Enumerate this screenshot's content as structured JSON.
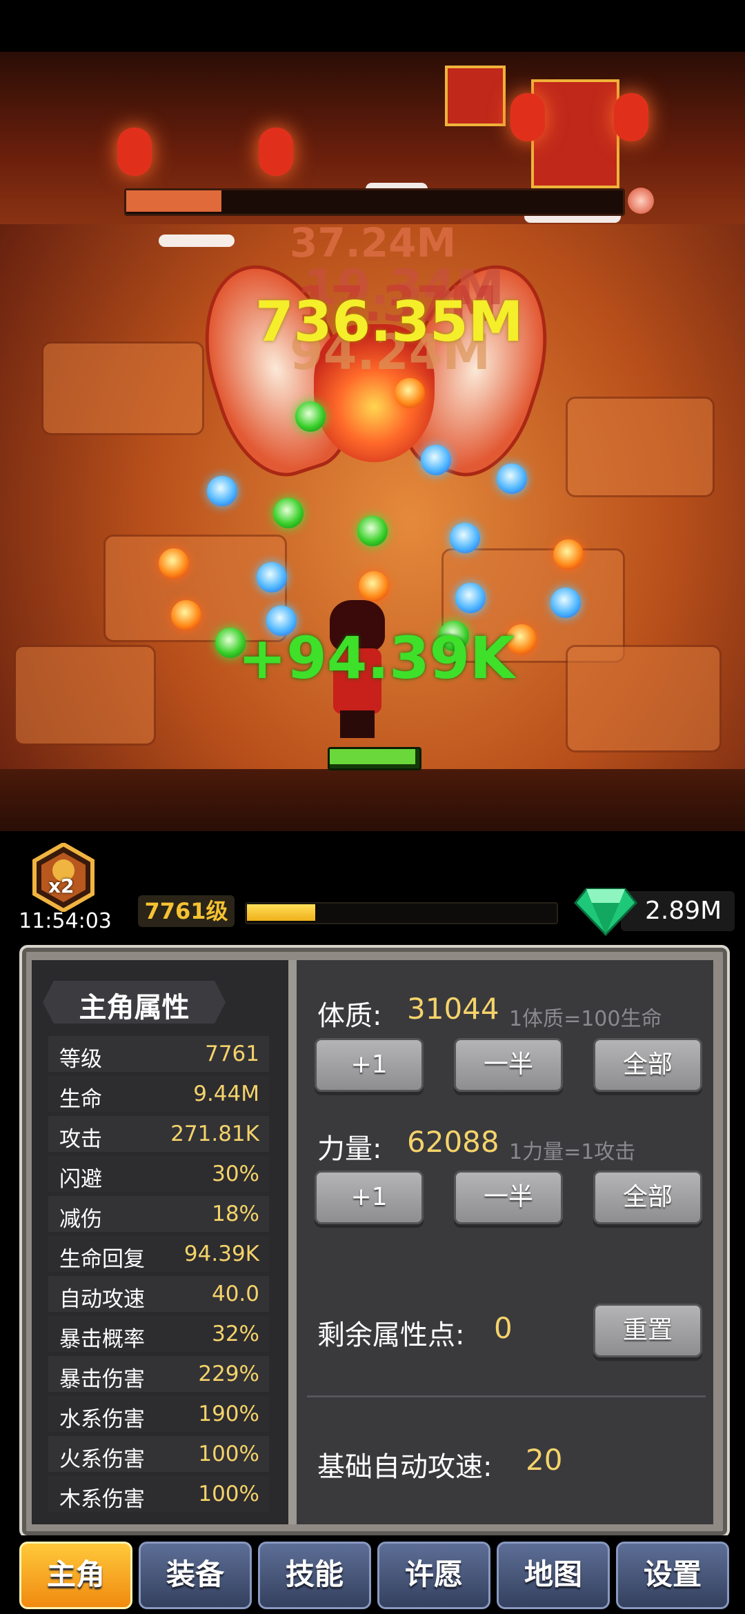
{
  "battle": {
    "damage_numbers": [
      "37.24M",
      "19.34M",
      "17.37M",
      "736.35M",
      "94.24M"
    ],
    "heal_text": "+94.39K"
  },
  "status": {
    "boost_label": "x2",
    "boost_timer": "11:54:03",
    "level_label": "7761级",
    "xp_progress_fraction": 0.22,
    "gem_amount": "2.89M"
  },
  "attributes_panel": {
    "title": "主角属性",
    "stats": [
      {
        "label": "等级",
        "value": "7761"
      },
      {
        "label": "生命",
        "value": "9.44M"
      },
      {
        "label": "攻击",
        "value": "271.81K"
      },
      {
        "label": "闪避",
        "value": "30%"
      },
      {
        "label": "减伤",
        "value": "18%"
      },
      {
        "label": "生命回复",
        "value": "94.39K"
      },
      {
        "label": "自动攻速",
        "value": "40.0"
      },
      {
        "label": "暴击概率",
        "value": "32%"
      },
      {
        "label": "暴击伤害",
        "value": "229%"
      },
      {
        "label": "水系伤害",
        "value": "190%"
      },
      {
        "label": "火系伤害",
        "value": "100%"
      },
      {
        "label": "木系伤害",
        "value": "100%"
      }
    ]
  },
  "allocation": {
    "constitution": {
      "label": "体质:",
      "value": "31044",
      "hint": "1体质=100生命"
    },
    "strength": {
      "label": "力量:",
      "value": "62088",
      "hint": "1力量=1攻击"
    },
    "buttons": {
      "plus_one": "+1",
      "half": "一半",
      "all": "全部"
    },
    "remaining_label": "剩余属性点:",
    "remaining_value": "0",
    "reset_button": "重置",
    "base_speed_label": "基础自动攻速:",
    "base_speed_value": "20"
  },
  "nav": {
    "tabs": [
      "主角",
      "装备",
      "技能",
      "许愿",
      "地图",
      "设置"
    ],
    "active_index": 0
  },
  "colors": {
    "accent_gold": "#f5d36a",
    "heal_green": "#3ee02a",
    "active_tab": "#f5a020",
    "gem": "#2ee08a"
  },
  "icons": [
    "multiplier-badge-icon",
    "gem-icon",
    "hero-character",
    "boss-character"
  ]
}
